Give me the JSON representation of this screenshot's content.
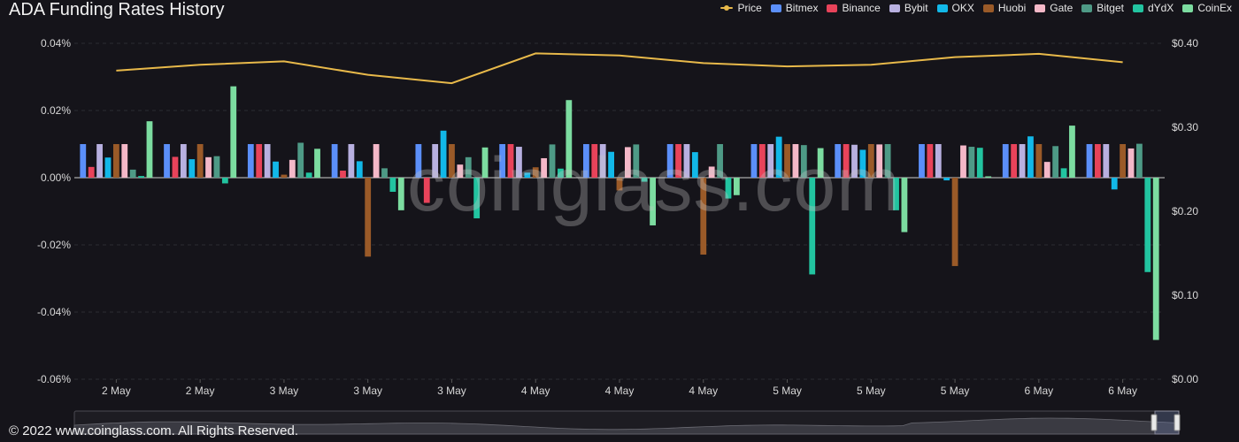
{
  "header": {
    "title": "ADA Funding Rates History"
  },
  "footer": {
    "copyright": "© 2022 www.coinglass.com. All Rights Reserved."
  },
  "watermark": {
    "text": "coinglass.com"
  },
  "colors": {
    "background": "#15141a",
    "grid": "#2c2c33",
    "zero_line": "#cfcfcf",
    "axis_text": "#d8d8d8",
    "Price": "#e8b94a",
    "Bitmex": "#5b8ff9",
    "Binance": "#e8435a",
    "Bybit": "#b8b0e0",
    "OKX": "#12b8e8",
    "Huobi": "#9a5a28",
    "Gate": "#f4b8c8",
    "Bitget": "#4e9a86",
    "dYdX": "#22c4a0",
    "CoinEx": "#7cdca0"
  },
  "chart_data": {
    "type": "bar",
    "title": "ADA Funding Rates History",
    "categories": [
      "2 May",
      "2 May",
      "3 May",
      "3 May",
      "3 May",
      "4 May",
      "4 May",
      "4 May",
      "5 May",
      "5 May",
      "5 May",
      "6 May",
      "6 May"
    ],
    "y_left": {
      "ticks": [
        "0.04%",
        "0.02%",
        "0.00%",
        "-0.02%",
        "-0.04%",
        "-0.06%"
      ],
      "ylim": [
        -0.06,
        0.04
      ],
      "unit": "%"
    },
    "y_right": {
      "ticks": [
        "$0.40",
        "$0.30",
        "$0.20",
        "$0.10",
        "$0.00"
      ],
      "ylim": [
        0,
        0.4
      ],
      "unit": "$"
    },
    "grid": true,
    "legend_position": "top-right",
    "legend": [
      "Price",
      "Bitmex",
      "Binance",
      "Bybit",
      "OKX",
      "Huobi",
      "Gate",
      "Bitget",
      "dYdX",
      "CoinEx"
    ],
    "series": [
      {
        "name": "Bitmex",
        "values": [
          0.01,
          0.01,
          0.01,
          0.01,
          0.01,
          0.01,
          0.01,
          0.01,
          0.01,
          0.01,
          0.01,
          0.01,
          0.01
        ]
      },
      {
        "name": "Binance",
        "values": [
          0.0032,
          0.0062,
          0.01,
          0.0021,
          -0.0075,
          0.01,
          0.01,
          0.01,
          0.01,
          0.01,
          0.01,
          0.01,
          0.01
        ]
      },
      {
        "name": "Bybit",
        "values": [
          0.01,
          0.01,
          0.01,
          0.01,
          0.01,
          0.0092,
          0.01,
          0.01,
          0.01,
          0.0098,
          0.01,
          0.01,
          0.01
        ]
      },
      {
        "name": "OKX",
        "values": [
          0.006,
          0.0055,
          0.0048,
          0.0049,
          0.014,
          0.0015,
          0.0077,
          0.0076,
          0.0122,
          0.0083,
          -0.0008,
          0.0123,
          -0.0035
        ]
      },
      {
        "name": "Huobi",
        "values": [
          0.01,
          0.01,
          0.0009,
          -0.0235,
          0.01,
          0.0031,
          -0.0038,
          -0.0229,
          0.01,
          0.01,
          -0.0263,
          0.01,
          0.01
        ]
      },
      {
        "name": "Gate",
        "values": [
          0.01,
          0.0061,
          0.0053,
          0.01,
          0.0039,
          0.0058,
          0.0091,
          0.0033,
          0.01,
          0.0099,
          0.0096,
          0.0047,
          0.0087
        ]
      },
      {
        "name": "Bitget",
        "values": [
          0.0024,
          0.0064,
          0.0104,
          0.0028,
          0.0061,
          0.0099,
          0.0099,
          0.01,
          0.0097,
          0.01,
          0.0092,
          0.0094,
          0.0101
        ]
      },
      {
        "name": "dYdX",
        "values": [
          0.0005,
          -0.0017,
          0.0015,
          -0.0042,
          -0.0121,
          0.0027,
          -0.0012,
          -0.0062,
          -0.0288,
          -0.0097,
          0.0089,
          0.0028,
          -0.0281
        ]
      },
      {
        "name": "CoinEx",
        "values": [
          0.0168,
          0.0272,
          0.0086,
          -0.0097,
          0.009,
          0.0231,
          -0.0142,
          -0.0052,
          0.0088,
          -0.0162,
          0.0004,
          0.0155,
          -0.0483
        ]
      }
    ],
    "price": {
      "name": "Price",
      "values": [
        0.3675,
        0.3745,
        0.3785,
        0.3625,
        0.3525,
        0.388,
        0.3855,
        0.3765,
        0.3725,
        0.3745,
        0.3835,
        0.3875,
        0.3775
      ]
    }
  }
}
